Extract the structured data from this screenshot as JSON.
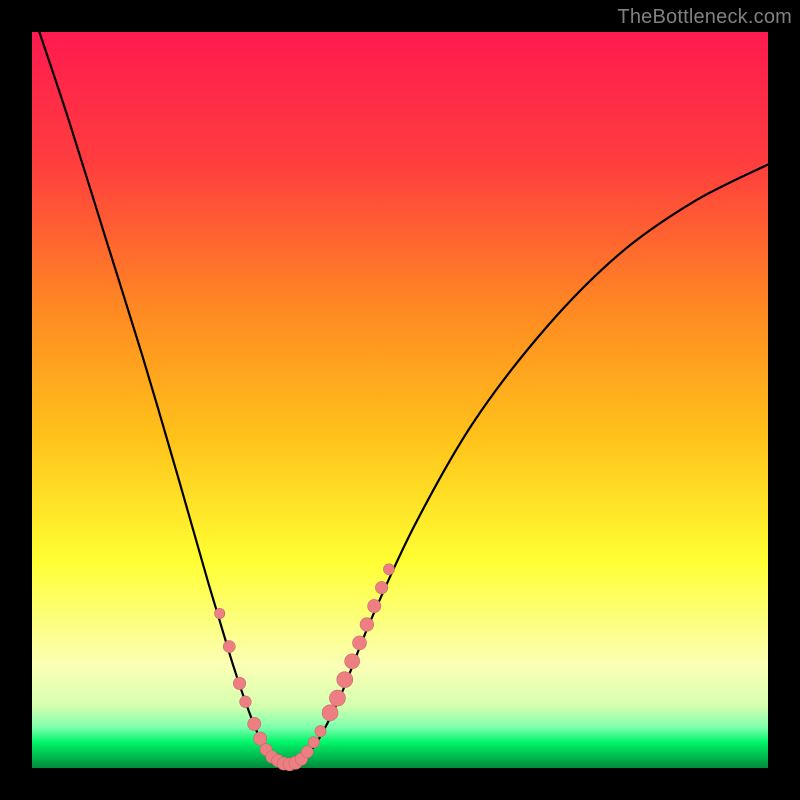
{
  "watermark": "TheBottleneck.com",
  "colors": {
    "black": "#000000",
    "curve": "#000000",
    "marker_fill": "#ed7f82",
    "marker_stroke": "#c76a6d",
    "grad_top": "#ff1a50",
    "grad_mid1": "#ff6a2d",
    "grad_mid2": "#ffc21a",
    "grad_mid3": "#ffff33",
    "grad_pale": "#fbffb5",
    "grad_green": "#00f56a",
    "grad_deep_green": "#008a3c"
  },
  "chart_data": {
    "type": "line",
    "title": "",
    "xlabel": "",
    "ylabel": "",
    "xlim": [
      0,
      100
    ],
    "ylim": [
      0,
      100
    ],
    "curve": {
      "name": "bottleneck-curve",
      "points": [
        {
          "x": 1,
          "y": 100
        },
        {
          "x": 5,
          "y": 88
        },
        {
          "x": 10,
          "y": 72
        },
        {
          "x": 15,
          "y": 56
        },
        {
          "x": 20,
          "y": 39
        },
        {
          "x": 24,
          "y": 25
        },
        {
          "x": 27,
          "y": 15
        },
        {
          "x": 29,
          "y": 9
        },
        {
          "x": 31,
          "y": 4
        },
        {
          "x": 33,
          "y": 1.5
        },
        {
          "x": 35,
          "y": 0.5
        },
        {
          "x": 37,
          "y": 1.5
        },
        {
          "x": 39,
          "y": 4
        },
        {
          "x": 42,
          "y": 10
        },
        {
          "x": 46,
          "y": 20
        },
        {
          "x": 52,
          "y": 33
        },
        {
          "x": 60,
          "y": 47
        },
        {
          "x": 70,
          "y": 60
        },
        {
          "x": 80,
          "y": 70
        },
        {
          "x": 90,
          "y": 77
        },
        {
          "x": 100,
          "y": 82
        }
      ]
    },
    "markers": [
      {
        "x": 25.5,
        "y": 21,
        "r": 5.2
      },
      {
        "x": 26.8,
        "y": 16.5,
        "r": 6.0
      },
      {
        "x": 28.2,
        "y": 11.5,
        "r": 6.2
      },
      {
        "x": 29.0,
        "y": 9.0,
        "r": 5.8
      },
      {
        "x": 30.2,
        "y": 6.0,
        "r": 6.6
      },
      {
        "x": 31.0,
        "y": 4.0,
        "r": 6.6
      },
      {
        "x": 31.8,
        "y": 2.5,
        "r": 6.0
      },
      {
        "x": 32.6,
        "y": 1.5,
        "r": 6.2
      },
      {
        "x": 33.4,
        "y": 1.0,
        "r": 6.2
      },
      {
        "x": 34.2,
        "y": 0.6,
        "r": 6.5
      },
      {
        "x": 35.0,
        "y": 0.5,
        "r": 6.5
      },
      {
        "x": 35.8,
        "y": 0.7,
        "r": 6.5
      },
      {
        "x": 36.6,
        "y": 1.2,
        "r": 6.2
      },
      {
        "x": 37.4,
        "y": 2.2,
        "r": 6.0
      },
      {
        "x": 38.3,
        "y": 3.5,
        "r": 5.6
      },
      {
        "x": 39.2,
        "y": 5.0,
        "r": 5.6
      },
      {
        "x": 40.5,
        "y": 7.5,
        "r": 8.0
      },
      {
        "x": 41.5,
        "y": 9.5,
        "r": 8.0
      },
      {
        "x": 42.5,
        "y": 12.0,
        "r": 8.0
      },
      {
        "x": 43.5,
        "y": 14.5,
        "r": 7.5
      },
      {
        "x": 44.5,
        "y": 17.0,
        "r": 7.0
      },
      {
        "x": 45.5,
        "y": 19.5,
        "r": 6.8
      },
      {
        "x": 46.5,
        "y": 22.0,
        "r": 6.6
      },
      {
        "x": 47.5,
        "y": 24.5,
        "r": 6.2
      },
      {
        "x": 48.5,
        "y": 27.0,
        "r": 5.5
      }
    ],
    "gradient_stops": [
      {
        "offset": 0.0,
        "color": "#ff1a50"
      },
      {
        "offset": 0.18,
        "color": "#ff3e3e"
      },
      {
        "offset": 0.38,
        "color": "#ff8a22"
      },
      {
        "offset": 0.55,
        "color": "#ffc21a"
      },
      {
        "offset": 0.72,
        "color": "#ffff33"
      },
      {
        "offset": 0.86,
        "color": "#fbffb5"
      },
      {
        "offset": 0.915,
        "color": "#d7ffb0"
      },
      {
        "offset": 0.945,
        "color": "#7dffad"
      },
      {
        "offset": 0.965,
        "color": "#00f56a"
      },
      {
        "offset": 0.985,
        "color": "#00b84e"
      },
      {
        "offset": 1.0,
        "color": "#008a3c"
      }
    ]
  }
}
